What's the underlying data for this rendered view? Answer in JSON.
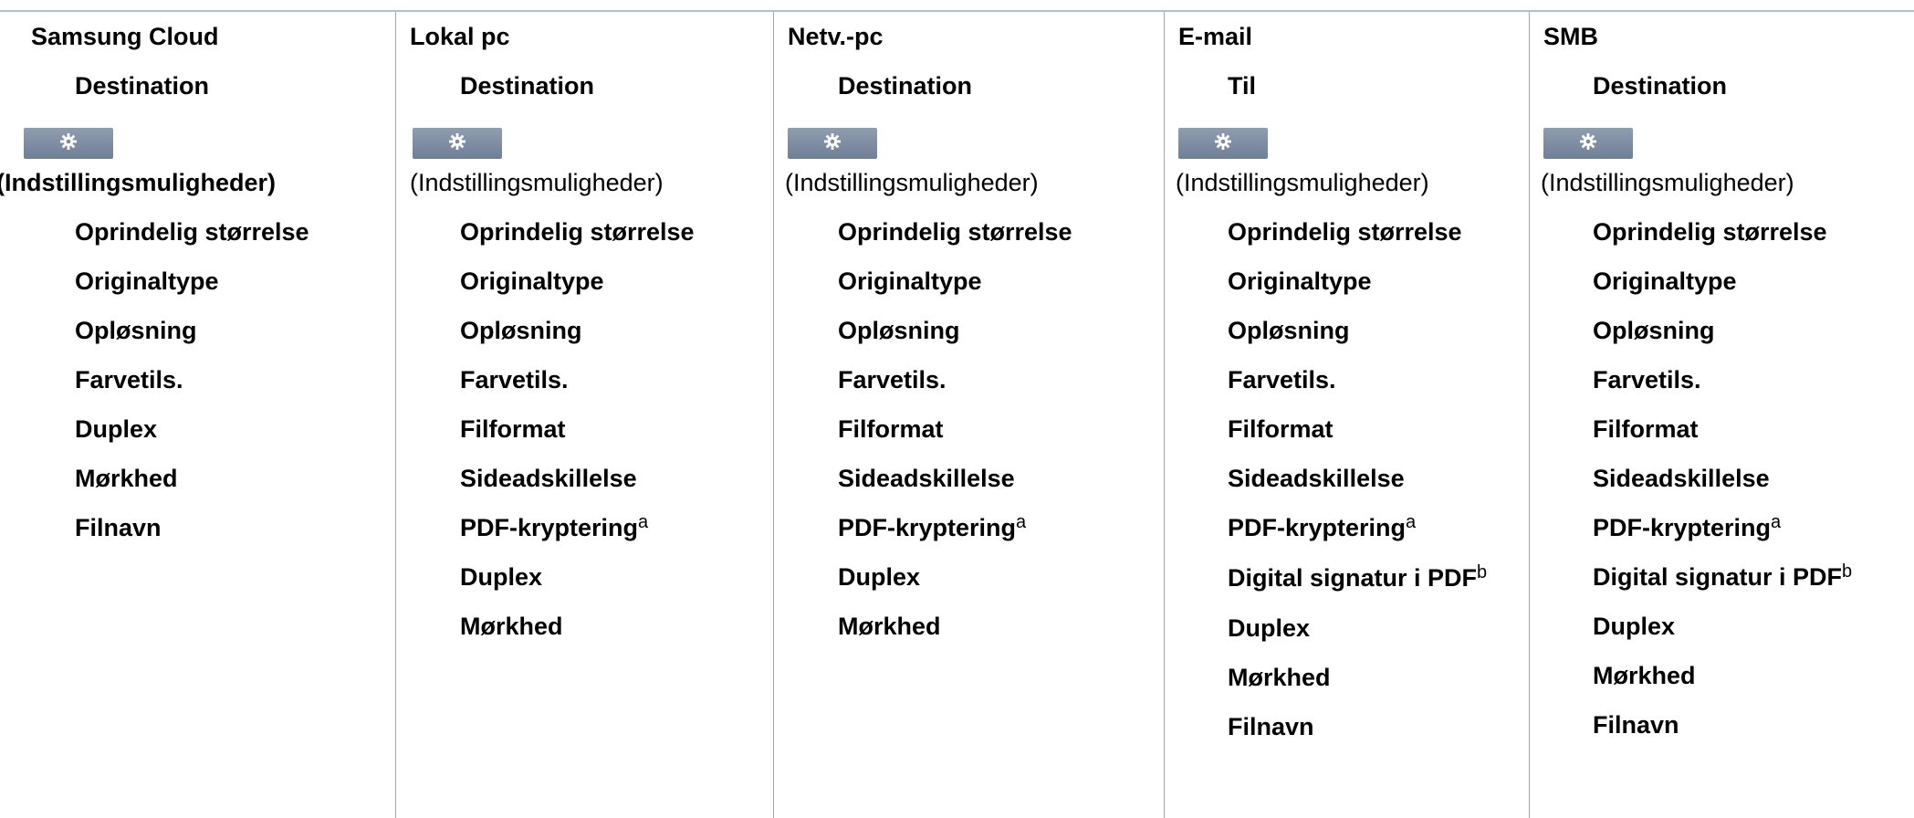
{
  "settings_icon": "gear-icon",
  "colors": {
    "rule": "#a9c1dc",
    "divider": "#8fa9cc",
    "button": "#7b8aa0"
  },
  "columns": [
    {
      "title": "Samsung Cloud",
      "destination": "Destination",
      "options_label": "(Indstillingsmuligheder)",
      "options_bold": true,
      "items": [
        {
          "text": "Oprindelig størrelse",
          "note": ""
        },
        {
          "text": "Originaltype",
          "note": ""
        },
        {
          "text": "Opløsning",
          "note": ""
        },
        {
          "text": "Farvetils.",
          "note": ""
        },
        {
          "text": "Duplex",
          "note": ""
        },
        {
          "text": "Mørkhed",
          "note": ""
        },
        {
          "text": "Filnavn",
          "note": ""
        }
      ]
    },
    {
      "title": "Lokal pc",
      "destination": "Destination",
      "options_label": "(Indstillingsmuligheder)",
      "options_bold": false,
      "items": [
        {
          "text": "Oprindelig størrelse",
          "note": ""
        },
        {
          "text": "Originaltype",
          "note": ""
        },
        {
          "text": "Opløsning",
          "note": ""
        },
        {
          "text": "Farvetils.",
          "note": ""
        },
        {
          "text": "Filformat",
          "note": ""
        },
        {
          "text": "Sideadskillelse",
          "note": ""
        },
        {
          "text": "PDF-kryptering",
          "note": "a"
        },
        {
          "text": "Duplex",
          "note": ""
        },
        {
          "text": "Mørkhed",
          "note": ""
        }
      ]
    },
    {
      "title": "Netv.-pc",
      "destination": "Destination",
      "options_label": "(Indstillingsmuligheder)",
      "options_bold": false,
      "items": [
        {
          "text": "Oprindelig størrelse",
          "note": ""
        },
        {
          "text": "Originaltype",
          "note": ""
        },
        {
          "text": "Opløsning",
          "note": ""
        },
        {
          "text": "Farvetils.",
          "note": ""
        },
        {
          "text": "Filformat",
          "note": ""
        },
        {
          "text": "Sideadskillelse",
          "note": ""
        },
        {
          "text": "PDF-kryptering",
          "note": "a"
        },
        {
          "text": "Duplex",
          "note": ""
        },
        {
          "text": "Mørkhed",
          "note": ""
        }
      ]
    },
    {
      "title": "E-mail",
      "destination": "Til",
      "options_label": "(Indstillingsmuligheder)",
      "options_bold": false,
      "items": [
        {
          "text": "Oprindelig størrelse",
          "note": ""
        },
        {
          "text": "Originaltype",
          "note": ""
        },
        {
          "text": "Opløsning",
          "note": ""
        },
        {
          "text": "Farvetils.",
          "note": ""
        },
        {
          "text": "Filformat",
          "note": ""
        },
        {
          "text": "Sideadskillelse",
          "note": ""
        },
        {
          "text": "PDF-kryptering",
          "note": "a"
        },
        {
          "text": "Digital signatur i PDF",
          "note": "b"
        },
        {
          "text": "Duplex",
          "note": ""
        },
        {
          "text": "Mørkhed",
          "note": ""
        },
        {
          "text": "Filnavn",
          "note": ""
        }
      ]
    },
    {
      "title": "SMB",
      "destination": "Destination",
      "options_label": "(Indstillingsmuligheder)",
      "options_bold": false,
      "items": [
        {
          "text": "Oprindelig størrelse",
          "note": ""
        },
        {
          "text": "Originaltype",
          "note": ""
        },
        {
          "text": "Opløsning",
          "note": ""
        },
        {
          "text": "Farvetils.",
          "note": ""
        },
        {
          "text": "Filformat",
          "note": ""
        },
        {
          "text": "Sideadskillelse",
          "note": ""
        },
        {
          "text": "PDF-kryptering",
          "note": "a"
        },
        {
          "text": "Digital signatur i PDF",
          "note": "b"
        },
        {
          "text": "Duplex",
          "note": ""
        },
        {
          "text": "Mørkhed",
          "note": ""
        },
        {
          "text": "Filnavn",
          "note": ""
        }
      ]
    }
  ]
}
